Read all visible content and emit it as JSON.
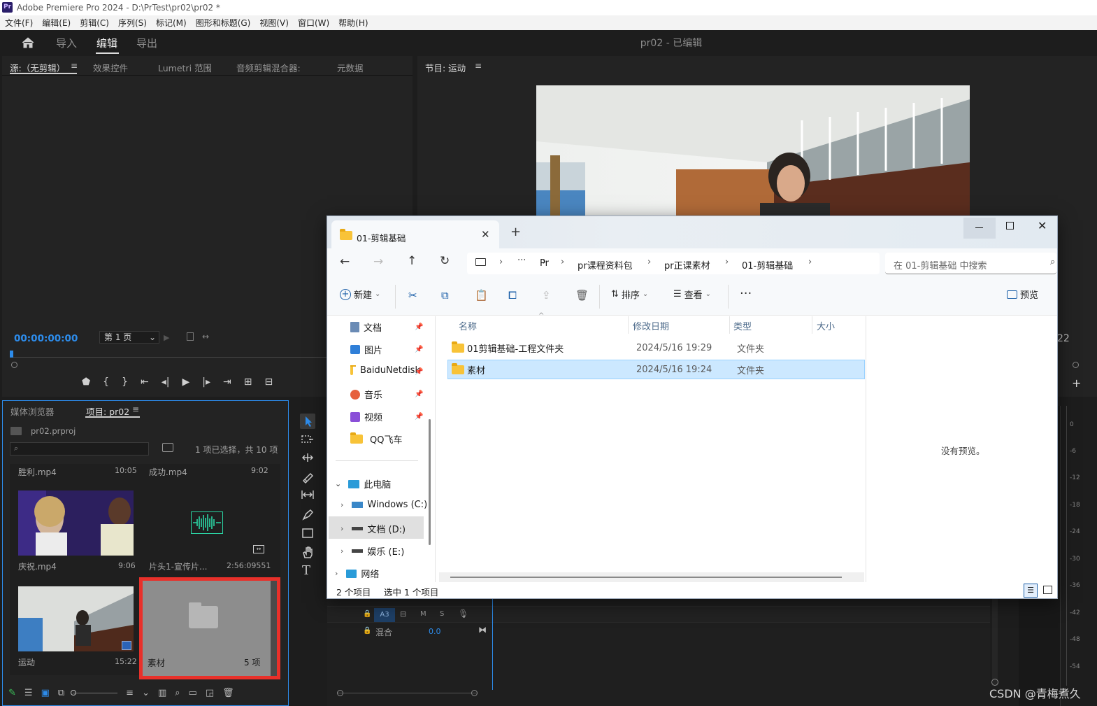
{
  "titlebar": {
    "logo": "Pr",
    "title": "Adobe Premiere Pro 2024 - D:\\PrTest\\pr02\\pr02 *"
  },
  "menu": [
    "文件(F)",
    "编辑(E)",
    "剪辑(C)",
    "序列(S)",
    "标记(M)",
    "图形和标题(G)",
    "视图(V)",
    "窗口(W)",
    "帮助(H)"
  ],
  "workspace": {
    "tabs": [
      "导入",
      "编辑",
      "导出"
    ],
    "active": "编辑",
    "project_title": "pr02 - 已编辑"
  },
  "source_panel": {
    "tabs": [
      "源:（无剪辑）",
      "效果控件",
      "Lumetri 范围",
      "音频剪辑混合器:",
      "元数据"
    ],
    "timecode": "00:00:00:00",
    "page_select": "第 1 页"
  },
  "program_panel": {
    "title": "节目: 运动",
    "timecode_tail": "22"
  },
  "project_panel": {
    "tabs": [
      "媒体浏览器",
      "项目: pr02"
    ],
    "file": "pr02.prproj",
    "status": "1 项已选择，共 10 项",
    "items": [
      {
        "name": "胜利.mp4",
        "duration": "10:05"
      },
      {
        "name": "成功.mp4",
        "duration": "9:02"
      },
      {
        "name": "庆祝.mp4",
        "duration": "9:06"
      },
      {
        "name": "片头1-宣传片...",
        "duration": "2:56:09551"
      },
      {
        "name": "运动",
        "duration": "15:22"
      },
      {
        "name": "素材",
        "duration": "5 项"
      }
    ]
  },
  "timeline": {
    "track": "A3",
    "m": "M",
    "s": "S",
    "mix_label": "混合",
    "mix_value": "0.0"
  },
  "meter_scale": [
    "0",
    "-6",
    "-12",
    "-18",
    "-24",
    "-30",
    "-36",
    "-42",
    "-48",
    "-54"
  ],
  "explorer": {
    "tab_title": "01-剪辑基础",
    "breadcrumb": [
      "Pr",
      "pr课程资料包",
      "pr正课素材",
      "01-剪辑基础"
    ],
    "search_placeholder": "在 01-剪辑基础 中搜索",
    "toolbar": {
      "new": "新建",
      "sort": "排序",
      "view": "查看",
      "preview": "预览"
    },
    "sidebar": {
      "quick": [
        "文档",
        "图片",
        "BaiduNetdisk",
        "音乐",
        "视频",
        "QQ飞车"
      ],
      "this_pc": "此电脑",
      "drives": [
        "Windows (C:)",
        "文档 (D:)",
        "娱乐 (E:)"
      ],
      "network": "网络"
    },
    "columns": [
      "名称",
      "修改日期",
      "类型",
      "大小"
    ],
    "rows": [
      {
        "name": "01剪辑基础-工程文件夹",
        "date": "2024/5/16 19:29",
        "type": "文件夹"
      },
      {
        "name": "素材",
        "date": "2024/5/16 19:24",
        "type": "文件夹"
      }
    ],
    "no_preview": "没有预览。",
    "status_items": "2 个项目",
    "status_selected": "选中 1 个项目"
  },
  "watermark": "CSDN @青梅煮久"
}
